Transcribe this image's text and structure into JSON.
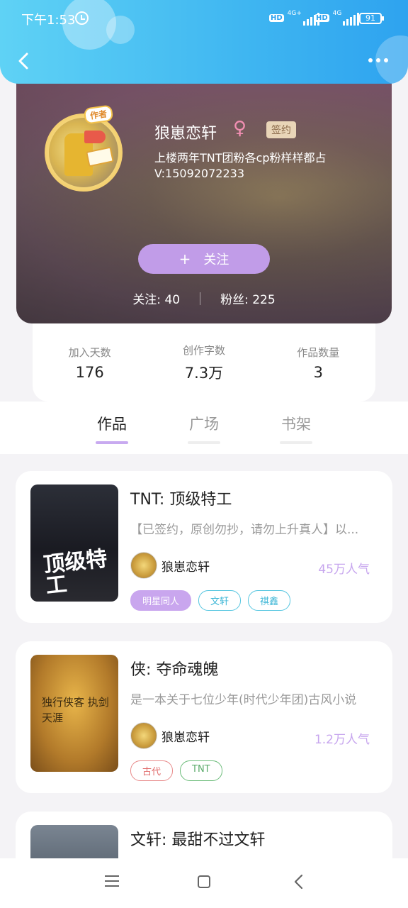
{
  "status_bar": {
    "time": "下午1:53",
    "network_1": "4G+",
    "network_2": "4G",
    "hd_1": "HD",
    "hd_2": "HD",
    "battery": "91"
  },
  "header": {
    "back_icon": "chevron-left-icon",
    "more_icon": "more-dots-icon"
  },
  "profile": {
    "avatar_tag": "作者",
    "name": "狼崽恋轩",
    "gender_symbol": "♀",
    "signed_badge": "签约",
    "bio_line1": "上楼两年TNT团粉各cp粉样样都占",
    "bio_line2": "V:15092072233",
    "follow_button": {
      "plus": "+",
      "label": "关注"
    },
    "following": "关注: 40",
    "fans": "粉丝: 225"
  },
  "stats": [
    {
      "label": "加入天数",
      "value": "176"
    },
    {
      "label": "创作字数",
      "value": "7.3万"
    },
    {
      "label": "作品数量",
      "value": "3"
    }
  ],
  "tabs": [
    {
      "label": "作品",
      "active": true
    },
    {
      "label": "广场",
      "active": false
    },
    {
      "label": "书架",
      "active": false
    }
  ],
  "books": [
    {
      "title": "TNT: 顶级特工",
      "cover_text": "顶级特工",
      "description": "【已签约，原创勿抄，请勿上升真人】以...",
      "author": "狼崽恋轩",
      "popularity": "45万人气",
      "tags": [
        "明星同人",
        "文轩",
        "祺鑫"
      ]
    },
    {
      "title": "侠: 夺命魂魄",
      "cover_text": "独行侠客 执剑天涯",
      "description": "是一本关于七位少年(时代少年团)古风小说",
      "author": "狼崽恋轩",
      "popularity": "1.2万人气",
      "tags": [
        "古代",
        "TNT"
      ]
    },
    {
      "title": "文轩: 最甜不过文轩"
    }
  ],
  "colors": {
    "header_blue": "#3fb6f1",
    "accent_purple": "#c19ce8"
  }
}
